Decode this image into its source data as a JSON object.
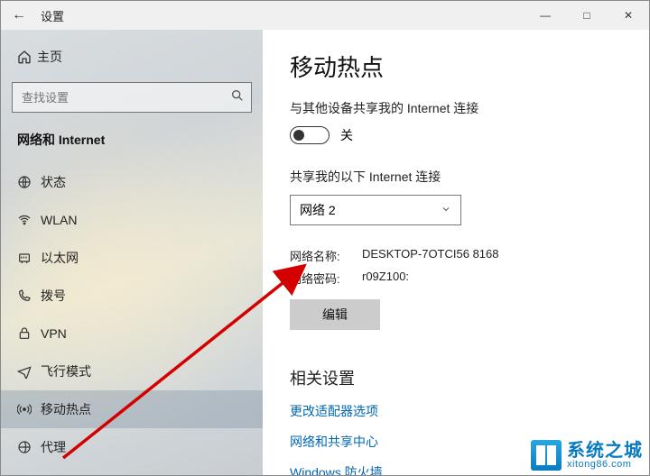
{
  "window": {
    "title": "设置"
  },
  "sidebar": {
    "home_label": "主页",
    "search_placeholder": "查找设置",
    "category_label": "网络和 Internet",
    "items": [
      {
        "label": "状态"
      },
      {
        "label": "WLAN"
      },
      {
        "label": "以太网"
      },
      {
        "label": "拨号"
      },
      {
        "label": "VPN"
      },
      {
        "label": "飞行模式"
      },
      {
        "label": "移动热点"
      },
      {
        "label": "代理"
      }
    ]
  },
  "main": {
    "page_title": "移动热点",
    "share_label": "与其他设备共享我的 Internet 连接",
    "toggle_state_label": "关",
    "share_from_label": "共享我的以下 Internet 连接",
    "connection_selected": "网络 2",
    "network_name_label": "网络名称:",
    "network_name_value": "DESKTOP-7OTCI56 8168",
    "network_password_label": "网络密码:",
    "network_password_value": "r09Z100:",
    "edit_button": "编辑",
    "related_header": "相关设置",
    "links": [
      "更改适配器选项",
      "网络和共享中心",
      "Windows 防火墙"
    ]
  },
  "watermark": {
    "cn": "系统之城",
    "en": "xitong86.com"
  }
}
